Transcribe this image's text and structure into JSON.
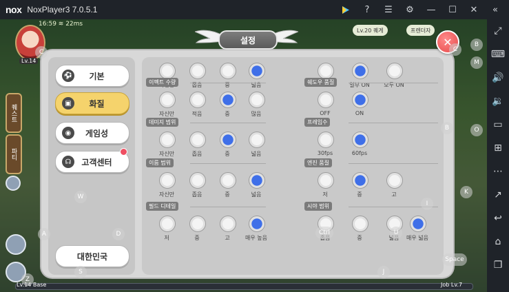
{
  "window": {
    "logo": "nox",
    "title": "NoxPlayer3 7.0.5.1"
  },
  "titlebar_icons": [
    "play-icon",
    "help-icon",
    "menu-icon",
    "gear-icon",
    "minimize-icon",
    "maximize-icon",
    "close-icon",
    "collapse-icon"
  ],
  "game_hud": {
    "level": "Lv.14",
    "status": "16:59 ≋ 22ms",
    "top_pill_1": "Lv.20 퀘게",
    "top_pill_2": "프렌더자",
    "bottom_left": "Lv.14 Base",
    "bottom_right": "Job Lv.7",
    "left_tab_1": "퀘스트",
    "left_tab_2": "파티"
  },
  "key_hints": {
    "c1": "C",
    "c2": "C",
    "b1": "B",
    "b2": "B",
    "m": "M",
    "o": "O",
    "k": "K",
    "i": "I",
    "w": "W",
    "a": "A",
    "d": "D",
    "s": "S",
    "z": "Z",
    "j": "J",
    "u": "U",
    "ctrl": "Ctrl",
    "space": "Space"
  },
  "dialog": {
    "title": "설정",
    "menu": [
      {
        "label": "기본",
        "icon": "soccer-ball-icon",
        "active": false
      },
      {
        "label": "화질",
        "icon": "image-icon",
        "active": true
      },
      {
        "label": "게임성",
        "icon": "gamepad-icon",
        "active": false
      },
      {
        "label": "고객센터",
        "icon": "headset-icon",
        "active": false
      }
    ],
    "country": "대한민국",
    "left_sections": [
      {
        "title": "",
        "options": [
          "자신만",
          "좁음",
          "중",
          "넓음"
        ],
        "selected": 3
      },
      {
        "title": "이펙트 수량",
        "options": [
          "자신만",
          "적음",
          "중",
          "많음"
        ],
        "selected": 2
      },
      {
        "title": "데미지 범위",
        "options": [
          "자신만",
          "좁음",
          "중",
          "넓음"
        ],
        "selected": 2
      },
      {
        "title": "이름 범위",
        "options": [
          "자신만",
          "좁음",
          "중",
          "넓음"
        ],
        "selected": 3
      },
      {
        "title": "필드 디테일",
        "options": [
          "저",
          "중",
          "고",
          "매우 높음"
        ],
        "selected": 3
      }
    ],
    "right_sections": [
      {
        "title": "",
        "options": [
          "OFF",
          "일부 ON",
          "모두 ON"
        ],
        "selected": 1
      },
      {
        "title": "쉐도우 품질",
        "options": [
          "OFF",
          "ON"
        ],
        "selected": 1
      },
      {
        "title": "프레임수",
        "options": [
          "30fps",
          "60fps"
        ],
        "selected": 1
      },
      {
        "title": "엔진 품질",
        "options": [
          "저",
          "중",
          "고"
        ],
        "selected": 1
      },
      {
        "title": "시야 범위",
        "options": [
          "좁음",
          "중",
          "넓음",
          "매우 넓음"
        ],
        "selected": 3
      }
    ]
  }
}
